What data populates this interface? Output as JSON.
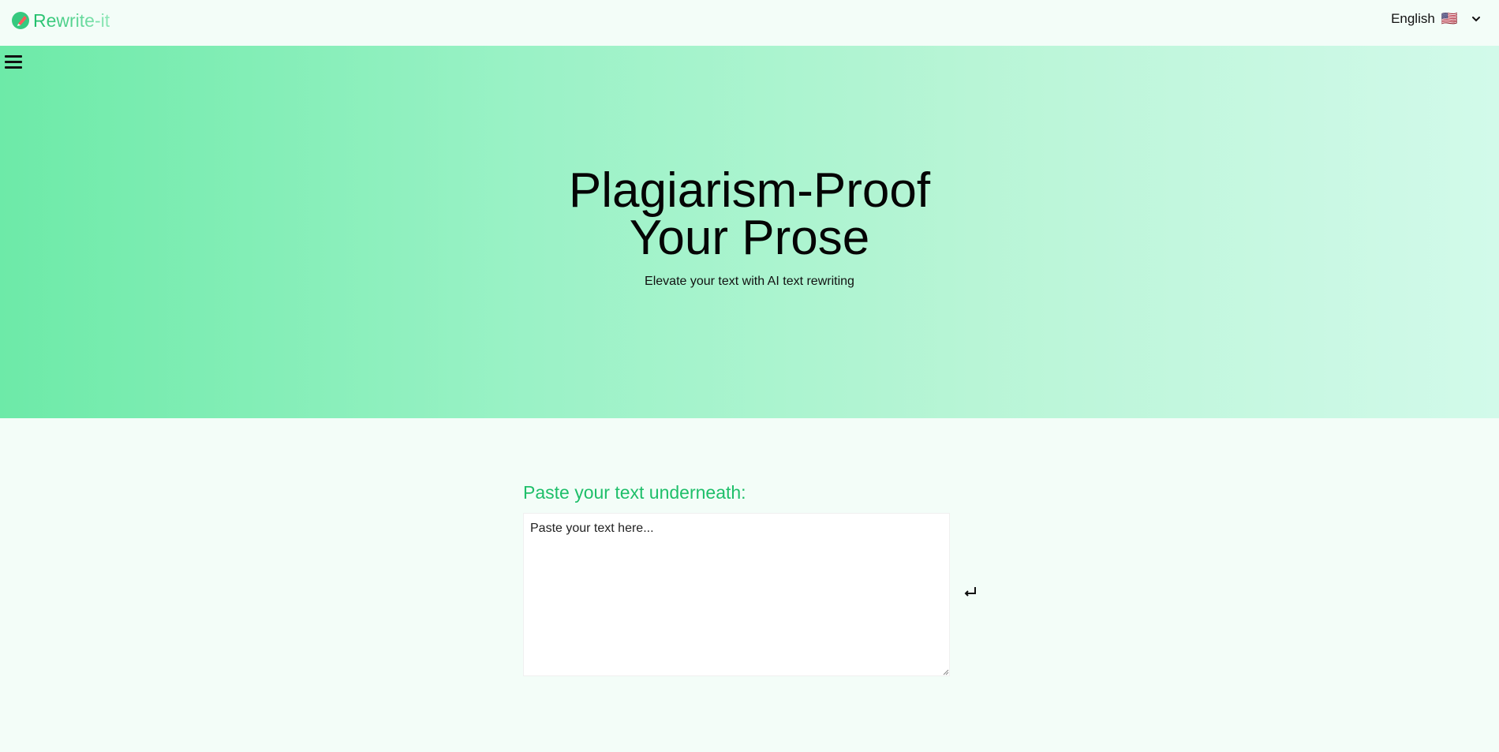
{
  "header": {
    "logo_text": "Rewrite-it",
    "language_label": "English",
    "language_flag": "🇺🇸"
  },
  "hero": {
    "title_line1": "Plagiarism-Proof",
    "title_line2": "Your Prose",
    "subtitle": "Elevate your text with AI text rewriting"
  },
  "editor": {
    "label": "Paste your text underneath:",
    "placeholder": "Paste your text here...",
    "value": ""
  },
  "icons": {
    "logo": "logo-icon",
    "menu": "hamburger-menu-icon",
    "chevron": "chevron-down-icon",
    "submit": "enter-return-icon"
  },
  "colors": {
    "accent": "#1fbf6a",
    "hero_start": "#6deaa8",
    "hero_end": "#d2faea",
    "page_bg": "#f3fdf8"
  }
}
